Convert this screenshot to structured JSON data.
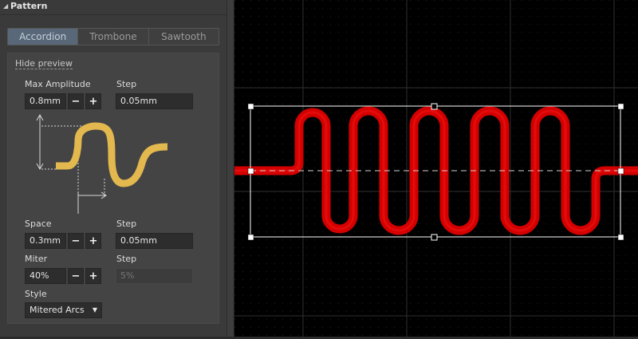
{
  "panel": {
    "title": "Pattern",
    "tabs": [
      {
        "label": "Accordion",
        "active": true
      },
      {
        "label": "Trombone",
        "active": false
      },
      {
        "label": "Sawtooth",
        "active": false
      }
    ],
    "hide_preview": "Hide preview"
  },
  "fields": {
    "max_amplitude": {
      "label": "Max Amplitude",
      "value": "0.8mm"
    },
    "amplitude_step": {
      "label": "Step",
      "value": "0.05mm"
    },
    "space": {
      "label": "Space",
      "value": "0.3mm"
    },
    "space_step": {
      "label": "Step",
      "value": "0.05mm"
    },
    "miter": {
      "label": "Miter",
      "value": "40%"
    },
    "miter_step": {
      "label": "Step",
      "value": "5%"
    },
    "style": {
      "label": "Style",
      "value": "Mitered Arcs"
    }
  },
  "stepper": {
    "minus": "−",
    "plus": "+"
  },
  "icons": {
    "collapse": "triangle-down-icon",
    "dropdown": "chevron-down-icon"
  },
  "colors": {
    "trace": "#e00000",
    "preview_trace": "#e3b84e",
    "canvas": "#000000",
    "active_tab": "#586878"
  }
}
